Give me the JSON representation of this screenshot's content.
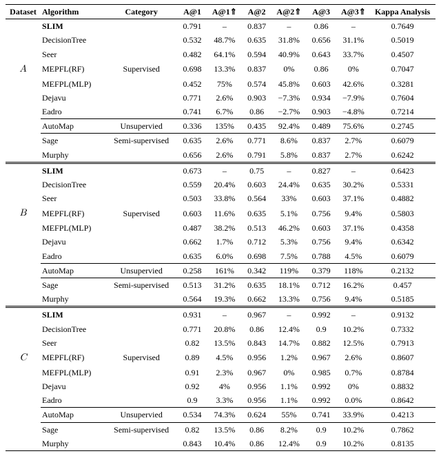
{
  "chart_data": {
    "type": "table",
    "title": "",
    "columns": [
      "Dataset",
      "Algorithm",
      "Category",
      "A@1",
      "A@1↑",
      "A@2",
      "A@2↑",
      "A@3",
      "A@3↑",
      "Kappa Analysis"
    ],
    "datasets": [
      {
        "name": "A",
        "rows": [
          {
            "alg": "SLIM",
            "cat": "Supervised",
            "a1": 0.791,
            "a1u": null,
            "a2": 0.837,
            "a2u": null,
            "a3": 0.86,
            "a3u": null,
            "kappa": 0.7649,
            "bold": true
          },
          {
            "alg": "DecisionTree",
            "cat": "Supervised",
            "a1": 0.532,
            "a1u": "48.7%",
            "a2": 0.635,
            "a2u": "31.8%",
            "a3": 0.656,
            "a3u": "31.1%",
            "kappa": 0.5019
          },
          {
            "alg": "Seer",
            "cat": "Supervised",
            "a1": 0.482,
            "a1u": "64.1%",
            "a2": 0.594,
            "a2u": "40.9%",
            "a3": 0.643,
            "a3u": "33.7%",
            "kappa": 0.4507
          },
          {
            "alg": "MEPFL(RF)",
            "cat": "Supervised",
            "a1": 0.698,
            "a1u": "13.3%",
            "a2": 0.837,
            "a2u": "0%",
            "a3": 0.86,
            "a3u": "0%",
            "kappa": 0.7047
          },
          {
            "alg": "MEFPL(MLP)",
            "cat": "Supervised",
            "a1": 0.452,
            "a1u": "75%",
            "a2": 0.574,
            "a2u": "45.8%",
            "a3": 0.603,
            "a3u": "42.6%",
            "kappa": 0.3281
          },
          {
            "alg": "Dejavu",
            "cat": "Supervised",
            "a1": 0.771,
            "a1u": "2.6%",
            "a2": 0.903,
            "a2u": "−7.3%",
            "a3": 0.934,
            "a3u": "−7.9%",
            "kappa": 0.7604
          },
          {
            "alg": "Eadro",
            "cat": "Supervised",
            "a1": 0.741,
            "a1u": "6.7%",
            "a2": 0.86,
            "a2u": "−2.7%",
            "a3": 0.903,
            "a3u": "−4.8%",
            "kappa": 0.7214
          },
          {
            "alg": "AutoMap",
            "cat": "Unsupervied",
            "a1": 0.336,
            "a1u": "135%",
            "a2": 0.435,
            "a2u": "92.4%",
            "a3": 0.489,
            "a3u": "75.6%",
            "kappa": 0.2745
          },
          {
            "alg": "Sage",
            "cat": "Semi-supervised",
            "a1": 0.635,
            "a1u": "2.6%",
            "a2": 0.771,
            "a2u": "8.6%",
            "a3": 0.837,
            "a3u": "2.7%",
            "kappa": 0.6079
          },
          {
            "alg": "Murphy",
            "cat": "Semi-supervised",
            "a1": 0.656,
            "a1u": "2.6%",
            "a2": 0.791,
            "a2u": "5.8%",
            "a3": 0.837,
            "a3u": "2.7%",
            "kappa": 0.6242
          }
        ]
      },
      {
        "name": "B",
        "rows": [
          {
            "alg": "SLIM",
            "cat": "Supervised",
            "a1": 0.673,
            "a1u": null,
            "a2": 0.75,
            "a2u": null,
            "a3": 0.827,
            "a3u": null,
            "kappa": 0.6423,
            "bold": true
          },
          {
            "alg": "DecisionTree",
            "cat": "Supervised",
            "a1": 0.559,
            "a1u": "20.4%",
            "a2": 0.603,
            "a2u": "24.4%",
            "a3": 0.635,
            "a3u": "30.2%",
            "kappa": 0.5331
          },
          {
            "alg": "Seer",
            "cat": "Supervised",
            "a1": 0.503,
            "a1u": "33.8%",
            "a2": 0.564,
            "a2u": "33%",
            "a3": 0.603,
            "a3u": "37.1%",
            "kappa": 0.4882
          },
          {
            "alg": "MEPFL(RF)",
            "cat": "Supervised",
            "a1": 0.603,
            "a1u": "11.6%",
            "a2": 0.635,
            "a2u": "5.1%",
            "a3": 0.756,
            "a3u": "9.4%",
            "kappa": 0.5803
          },
          {
            "alg": "MEFPL(MLP)",
            "cat": "Supervised",
            "a1": 0.487,
            "a1u": "38.2%",
            "a2": 0.513,
            "a2u": "46.2%",
            "a3": 0.603,
            "a3u": "37.1%",
            "kappa": 0.4358
          },
          {
            "alg": "Dejavu",
            "cat": "Supervised",
            "a1": 0.662,
            "a1u": "1.7%",
            "a2": 0.712,
            "a2u": "5.3%",
            "a3": 0.756,
            "a3u": "9.4%",
            "kappa": 0.6342
          },
          {
            "alg": "Eadro",
            "cat": "Supervised",
            "a1": 0.635,
            "a1u": "6.0%",
            "a2": 0.698,
            "a2u": "7.5%",
            "a3": 0.788,
            "a3u": "4.5%",
            "kappa": 0.6079
          },
          {
            "alg": "AutoMap",
            "cat": "Unsupervied",
            "a1": 0.258,
            "a1u": "161%",
            "a2": 0.342,
            "a2u": "119%",
            "a3": 0.379,
            "a3u": "118%",
            "kappa": 0.2132
          },
          {
            "alg": "Sage",
            "cat": "Semi-supervised",
            "a1": 0.513,
            "a1u": "31.2%",
            "a2": 0.635,
            "a2u": "18.1%",
            "a3": 0.712,
            "a3u": "16.2%",
            "kappa": 0.457
          },
          {
            "alg": "Murphy",
            "cat": "Semi-supervised",
            "a1": 0.564,
            "a1u": "19.3%",
            "a2": 0.662,
            "a2u": "13.3%",
            "a3": 0.756,
            "a3u": "9.4%",
            "kappa": 0.5185
          }
        ]
      },
      {
        "name": "C",
        "rows": [
          {
            "alg": "SLIM",
            "cat": "Supervised",
            "a1": 0.931,
            "a1u": null,
            "a2": 0.967,
            "a2u": null,
            "a3": 0.992,
            "a3u": null,
            "kappa": 0.9132,
            "bold": true
          },
          {
            "alg": "DecisionTree",
            "cat": "Supervised",
            "a1": 0.771,
            "a1u": "20.8%",
            "a2": 0.86,
            "a2u": "12.4%",
            "a3": 0.9,
            "a3u": "10.2%",
            "kappa": 0.7332
          },
          {
            "alg": "Seer",
            "cat": "Supervised",
            "a1": 0.82,
            "a1u": "13.5%",
            "a2": 0.843,
            "a2u": "14.7%",
            "a3": 0.882,
            "a3u": "12.5%",
            "kappa": 0.7913
          },
          {
            "alg": "MEPFL(RF)",
            "cat": "Supervised",
            "a1": 0.89,
            "a1u": "4.5%",
            "a2": 0.956,
            "a2u": "1.2%",
            "a3": 0.967,
            "a3u": "2.6%",
            "kappa": 0.8607
          },
          {
            "alg": "MEFPL(MLP)",
            "cat": "Supervised",
            "a1": 0.91,
            "a1u": "2.3%",
            "a2": 0.967,
            "a2u": "0%",
            "a3": 0.985,
            "a3u": "0.7%",
            "kappa": 0.8784
          },
          {
            "alg": "Dejavu",
            "cat": "Supervised",
            "a1": 0.92,
            "a1u": "4%",
            "a2": 0.956,
            "a2u": "1.1%",
            "a3": 0.992,
            "a3u": "0%",
            "kappa": 0.8832
          },
          {
            "alg": "Eadro",
            "cat": "Supervised",
            "a1": 0.9,
            "a1u": "3.3%",
            "a2": 0.956,
            "a2u": "1.1%",
            "a3": 0.992,
            "a3u": "0.0%",
            "kappa": 0.8642
          },
          {
            "alg": "AutoMap",
            "cat": "Unsupervied",
            "a1": 0.534,
            "a1u": "74.3%",
            "a2": 0.624,
            "a2u": "55%",
            "a3": 0.741,
            "a3u": "33.9%",
            "kappa": 0.4213
          },
          {
            "alg": "Sage",
            "cat": "Semi-supervised",
            "a1": 0.82,
            "a1u": "13.5%",
            "a2": 0.86,
            "a2u": "8.2%",
            "a3": 0.9,
            "a3u": "10.2%",
            "kappa": 0.7862
          },
          {
            "alg": "Murphy",
            "cat": "Semi-supervised",
            "a1": 0.843,
            "a1u": "10.4%",
            "a2": 0.86,
            "a2u": "12.4%",
            "a3": 0.9,
            "a3u": "10.2%",
            "kappa": 0.8135
          }
        ]
      }
    ]
  },
  "headers": {
    "dataset": "Dataset",
    "algorithm": "Algorithm",
    "category": "Category",
    "a1": "A@1",
    "a1u": "A@1⇑",
    "a2": "A@2",
    "a2u": "A@2⇑",
    "a3": "A@3",
    "a3u": "A@3⇑",
    "kappa": "Kappa Analysis"
  },
  "dash": "–"
}
